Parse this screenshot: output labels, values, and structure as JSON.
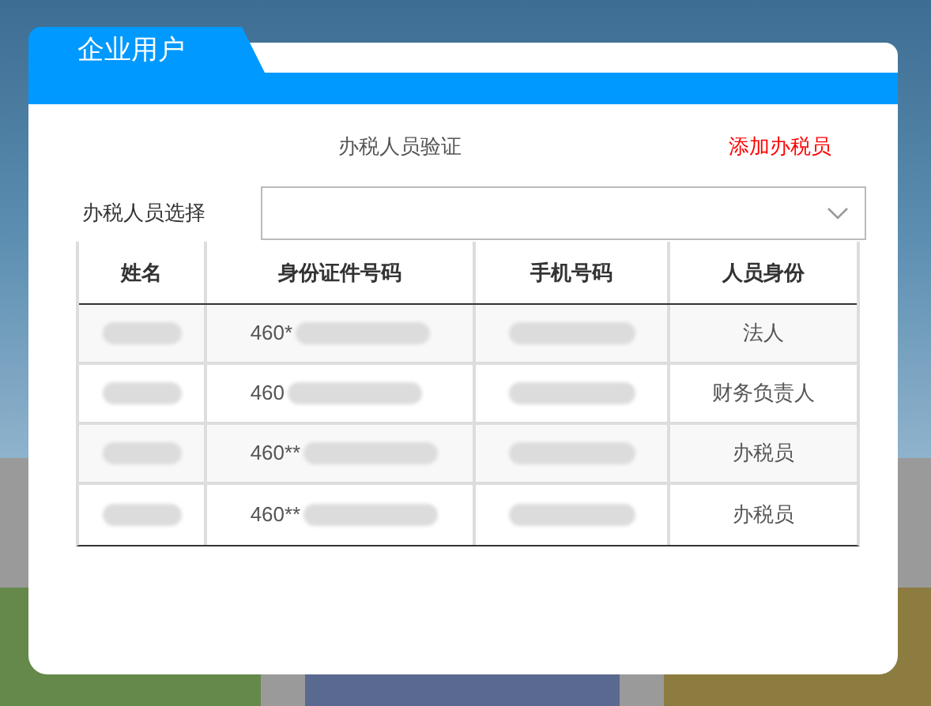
{
  "dialog": {
    "tab_title": "企业用户",
    "heading": "办税人员验证",
    "add_link": "添加办税员",
    "select_label": "办税人员选择"
  },
  "table": {
    "columns": [
      "姓名",
      "身份证件号码",
      "手机号码",
      "人员身份"
    ],
    "rows": [
      {
        "id_prefix": "460*",
        "role": "法人"
      },
      {
        "id_prefix": "460",
        "role": "财务负责人"
      },
      {
        "id_prefix": "460**",
        "role": "办税员"
      },
      {
        "id_prefix": "460**",
        "role": "办税员"
      }
    ]
  }
}
